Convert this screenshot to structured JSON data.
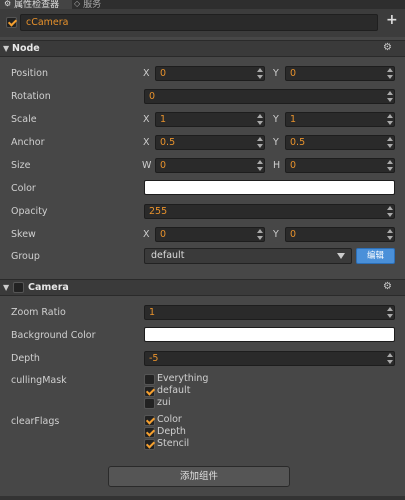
{
  "tabs": [
    {
      "label": "属性检查器",
      "icon": "settings-icon"
    },
    {
      "label": "服务",
      "icon": "eye-icon"
    }
  ],
  "node": {
    "enabled": true,
    "name": "cCamera",
    "add_icon": "+"
  },
  "node_section": {
    "title": "Node",
    "position": {
      "label": "Position",
      "x_axis": "X",
      "x": "0",
      "y_axis": "Y",
      "y": "0"
    },
    "rotation": {
      "label": "Rotation",
      "value": "0"
    },
    "scale": {
      "label": "Scale",
      "x_axis": "X",
      "x": "1",
      "y_axis": "Y",
      "y": "1"
    },
    "anchor": {
      "label": "Anchor",
      "x_axis": "X",
      "x": "0.5",
      "y_axis": "Y",
      "y": "0.5"
    },
    "size": {
      "label": "Size",
      "w_axis": "W",
      "w": "0",
      "h_axis": "H",
      "h": "0"
    },
    "color": {
      "label": "Color",
      "value": "#ffffff"
    },
    "opacity": {
      "label": "Opacity",
      "value": "255"
    },
    "skew": {
      "label": "Skew",
      "x_axis": "X",
      "x": "0",
      "y_axis": "Y",
      "y": "0"
    },
    "group": {
      "label": "Group",
      "value": "default",
      "edit_label": "编辑"
    }
  },
  "camera_section": {
    "title": "Camera",
    "enabled": false,
    "zoom_ratio": {
      "label": "Zoom Ratio",
      "value": "1"
    },
    "background_color": {
      "label": "Background Color",
      "value": "#ffffff"
    },
    "depth": {
      "label": "Depth",
      "value": "-5"
    },
    "culling_mask": {
      "label": "cullingMask",
      "options": [
        {
          "label": "Everything",
          "checked": false
        },
        {
          "label": "default",
          "checked": true
        },
        {
          "label": "zui",
          "checked": false
        }
      ]
    },
    "clear_flags": {
      "label": "clearFlags",
      "options": [
        {
          "label": "Color",
          "checked": true
        },
        {
          "label": "Depth",
          "checked": true
        },
        {
          "label": "Stencil",
          "checked": true
        }
      ]
    }
  },
  "add_component_label": "添加组件",
  "colors": {
    "accent": "#e8922c",
    "panel": "#474747",
    "button_blue": "#4a90d9"
  }
}
